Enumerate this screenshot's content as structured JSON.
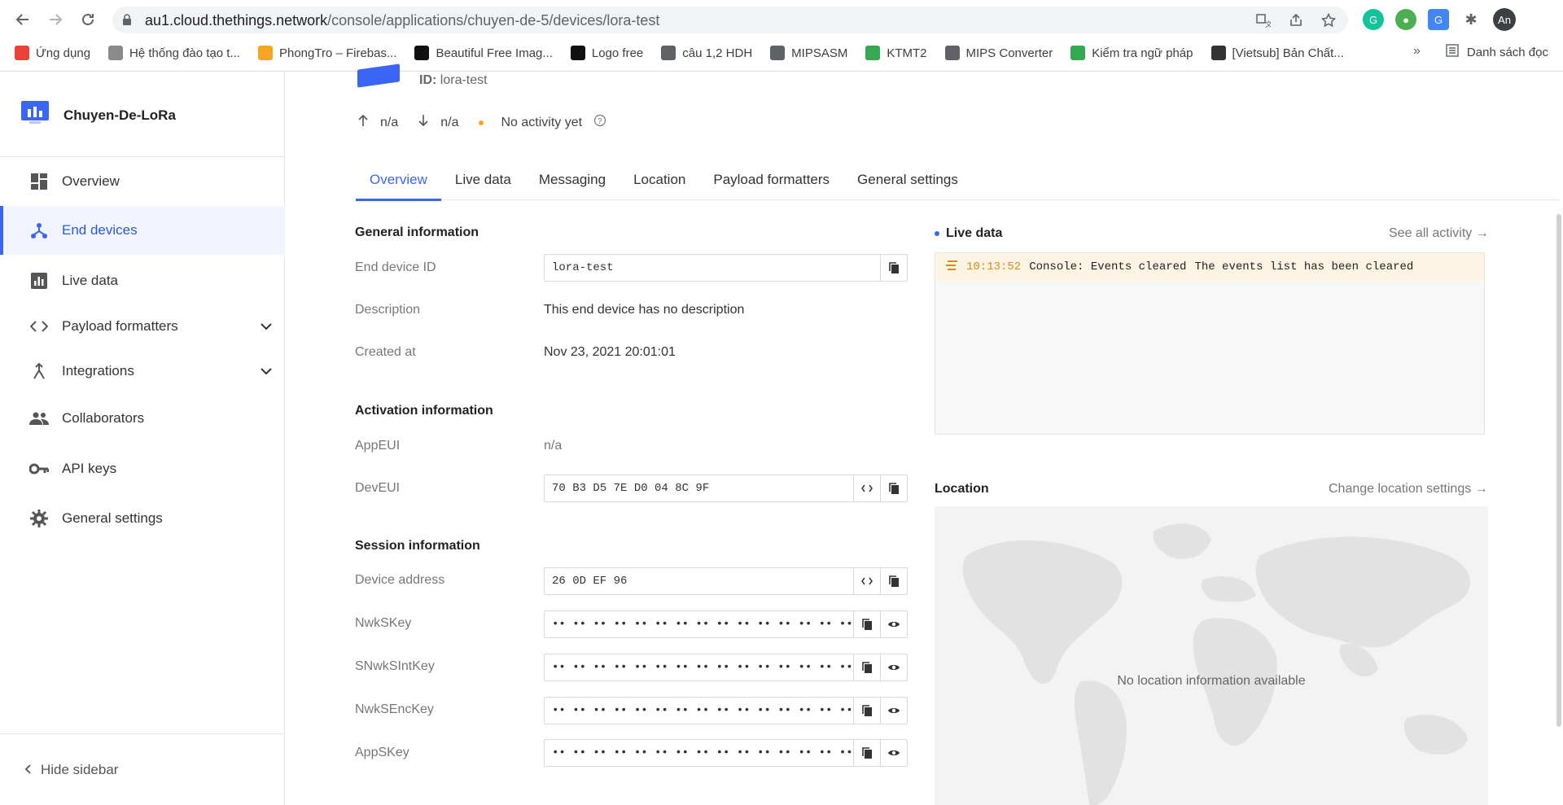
{
  "browser": {
    "url_host": "au1.cloud.thethings.network",
    "url_path": "/console/applications/chuyen-de-5/devices/lora-test",
    "profile_initials": "An",
    "bookmarks": [
      {
        "label": "Ứng dụng",
        "color": "#ea4335"
      },
      {
        "label": "Hệ thống đào tạo t...",
        "color": "#8a8a8a"
      },
      {
        "label": "PhongTro – Firebas...",
        "color": "#f6a623"
      },
      {
        "label": "Beautiful Free Imag...",
        "color": "#111111"
      },
      {
        "label": "Logo free",
        "color": "#111111"
      },
      {
        "label": "câu 1,2 HDH",
        "color": "#5f6368"
      },
      {
        "label": "MIPSASM",
        "color": "#5f6368"
      },
      {
        "label": "KTMT2",
        "color": "#34a853"
      },
      {
        "label": "MIPS Converter",
        "color": "#5f6368"
      },
      {
        "label": "Kiểm tra ngữ pháp",
        "color": "#34a853"
      },
      {
        "label": "[Vietsub] Bản Chất...",
        "color": "#333333"
      }
    ],
    "more_bookmarks": "»",
    "reading_list": "Danh sách đọc"
  },
  "sidebar": {
    "brand": "Chuyen-De-LoRa",
    "items": [
      {
        "label": "Overview",
        "icon": "dashboard-icon"
      },
      {
        "label": "End devices",
        "icon": "device-icon"
      },
      {
        "label": "Live data",
        "icon": "chart-icon"
      },
      {
        "label": "Payload formatters",
        "icon": "code-icon"
      },
      {
        "label": "Integrations",
        "icon": "merge-icon"
      },
      {
        "label": "Collaborators",
        "icon": "people-icon"
      },
      {
        "label": "API keys",
        "icon": "key-icon"
      },
      {
        "label": "General settings",
        "icon": "gear-icon"
      }
    ],
    "hide_label": "Hide sidebar"
  },
  "header": {
    "id_label": "ID:",
    "id_value": "lora-test",
    "uplink": "n/a",
    "downlink": "n/a",
    "activity": "No activity yet"
  },
  "tabs": [
    "Overview",
    "Live data",
    "Messaging",
    "Location",
    "Payload formatters",
    "General settings"
  ],
  "general": {
    "title": "General information",
    "end_device_id_label": "End device ID",
    "end_device_id": "lora-test",
    "description_label": "Description",
    "description": "This end device has no description",
    "created_label": "Created at",
    "created": "Nov 23, 2021 20:01:01"
  },
  "activation": {
    "title": "Activation information",
    "appeui_label": "AppEUI",
    "appeui": "n/a",
    "deveui_label": "DevEUI",
    "deveui": "70 B3 D5 7E D0 04 8C 9F"
  },
  "session": {
    "title": "Session information",
    "addr_label": "Device address",
    "addr": "26 0D EF 96",
    "nwkskey_label": "NwkSKey",
    "snwksintkey_label": "SNwkSIntKey",
    "nwksenckey_label": "NwkSEncKey",
    "appskey_label": "AppSKey",
    "masked": "•• •• •• •• •• •• •• •• •• •• •• •• •• •• •• ••"
  },
  "live": {
    "title": "Live data",
    "see_all": "See all activity →",
    "event_time": "10:13:52",
    "event_type": "Console: Events cleared",
    "event_msg": "The events list has been cleared"
  },
  "location": {
    "title": "Location",
    "change": "Change location settings →",
    "empty": "No location information available"
  }
}
